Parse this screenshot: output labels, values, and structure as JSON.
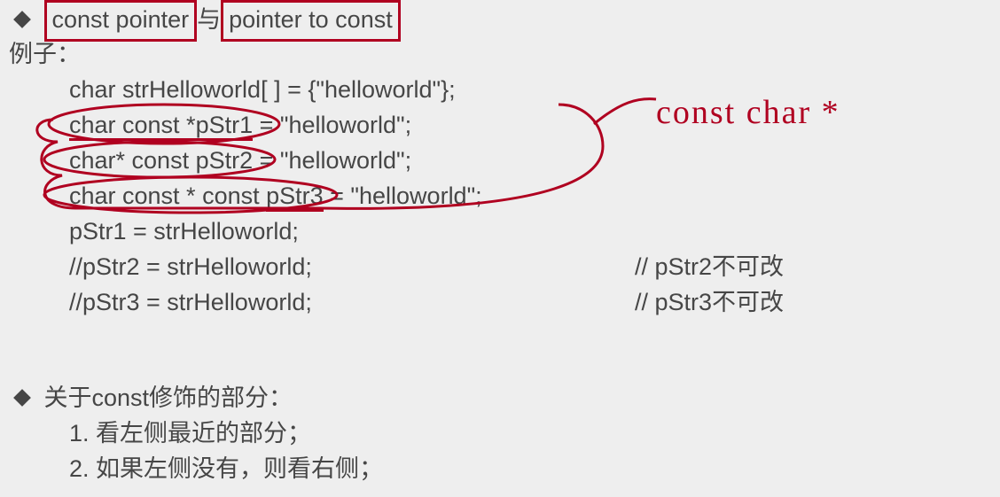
{
  "heading": {
    "box1": "const pointer",
    "middle": "与",
    "box2": "pointer to const"
  },
  "example_label": "例子：",
  "code": {
    "line1": "char strHelloworld[ ] = {\"helloworld\"};",
    "line2a": "char const *pStr1",
    "line2b": "  = \"helloworld\";",
    "line3": "char* const pStr2 = \"helloworld\";",
    "line4a": "char const * const ",
    "line4b": "pStr3",
    "line4c": " = \"helloworld\";",
    "line5": "pStr1 = strHelloworld;",
    "line6": "//pStr2 = strHelloworld;",
    "line6_cmt": "// pStr2不可改",
    "line7": "//pStr3 = strHelloworld;",
    "line7_cmt": "// pStr3不可改"
  },
  "handwritten": "const  char *",
  "section2_title": "关于const修饰的部分：",
  "rules": {
    "r1": "1. 看左侧最近的部分；",
    "r2": "2. 如果左侧没有，则看右侧；"
  }
}
